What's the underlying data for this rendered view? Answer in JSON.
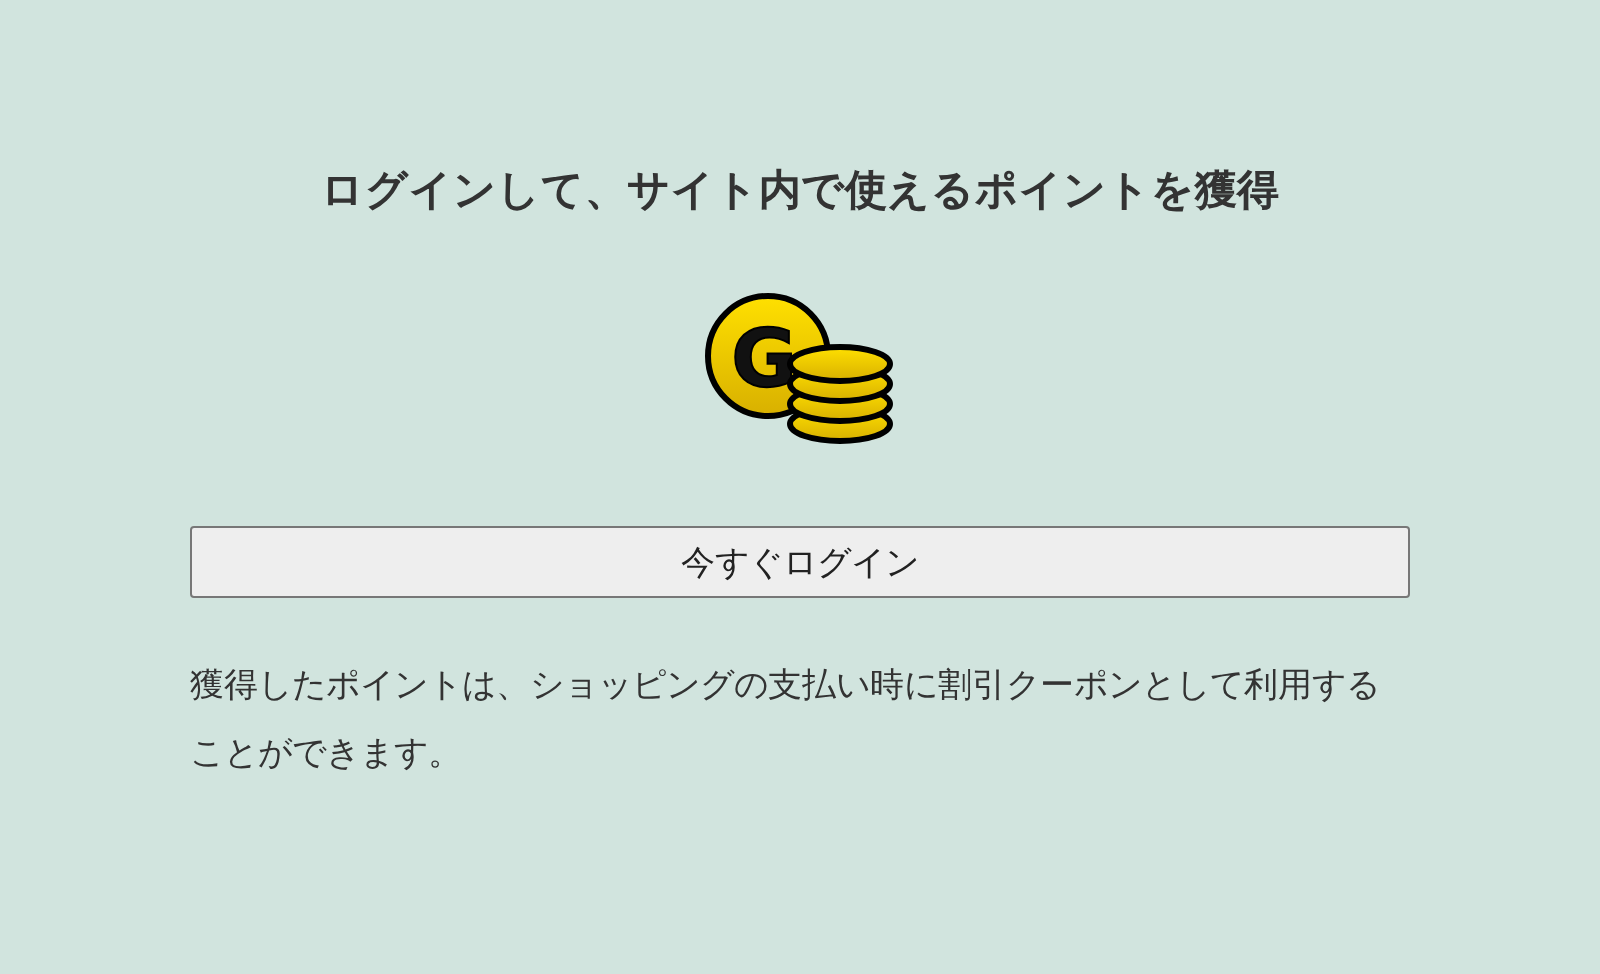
{
  "heading": "ログインして、サイト内で使えるポイントを獲得",
  "coin_icon": {
    "letter": "G"
  },
  "login_button": {
    "label": "今すぐログイン"
  },
  "description": "獲得したポイントは、ショッピングの支払い時に割引クーポンとして利用することができます。"
}
